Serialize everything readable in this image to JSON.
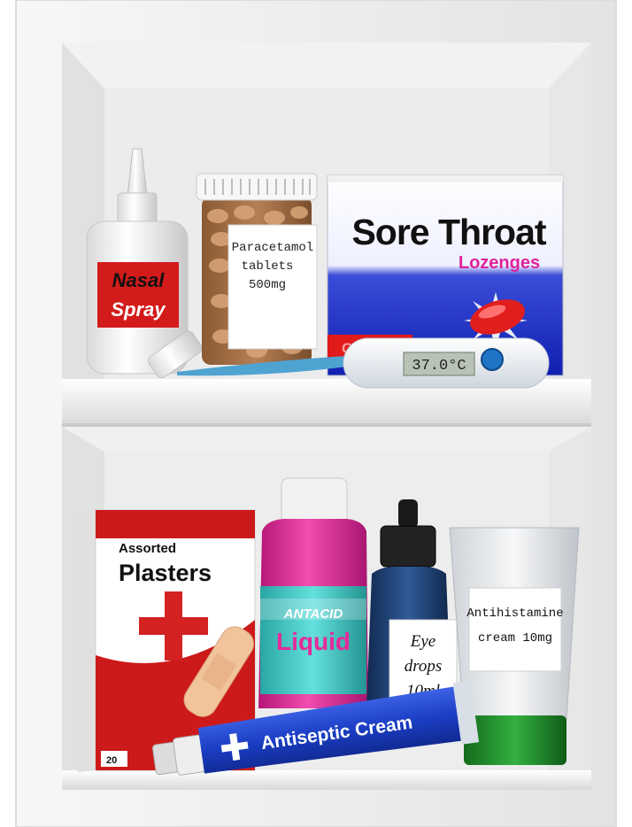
{
  "cabinet": {
    "top_shelf": {
      "nasal_spray": {
        "line1": "Nasal",
        "line2": "Spray"
      },
      "pill_bottle": {
        "line1": "Paracetamol",
        "line2": "tablets",
        "line3": "500mg"
      },
      "lozenges": {
        "title": "Sore Throat",
        "subtitle": "Lozenges",
        "flavor": "Cherry"
      },
      "thermometer": {
        "reading": "37.0°C"
      }
    },
    "bottom_shelf": {
      "plasters": {
        "small": "Assorted",
        "title": "Plasters",
        "count": "20"
      },
      "antacid": {
        "line1": "ANTACID",
        "line2": "Liquid"
      },
      "eye_drops": {
        "line1": "Eye",
        "line2": "drops",
        "line3": "10ml"
      },
      "antihistamine": {
        "line1": "Antihistamine",
        "line2": "cream 10mg"
      },
      "antiseptic": {
        "label": "Antiseptic Cream"
      }
    },
    "colors": {
      "cabinet_white": "#f4f4f4",
      "cross_red": "#d42222",
      "lozenge_blue": "#1a2fc8",
      "antacid_pink": "#e62a9a",
      "antacid_teal": "#3bc7c5",
      "eye_drops_navy": "#1d3f73",
      "antihistamine_green": "#1f8a2a",
      "antiseptic_blue": "#1b3ec4"
    }
  }
}
